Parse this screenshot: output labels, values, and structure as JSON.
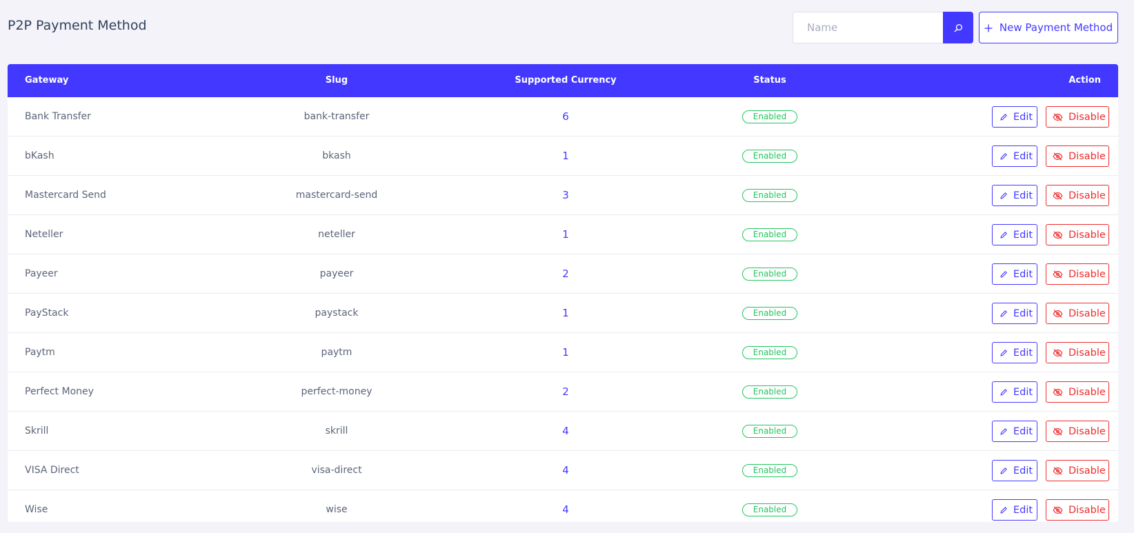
{
  "page": {
    "title": "P2P Payment Method"
  },
  "search": {
    "placeholder": "Name",
    "icon": "search-icon"
  },
  "new_button": {
    "label": "New Payment Method",
    "icon": "plus-icon"
  },
  "table": {
    "headers": {
      "gateway": "Gateway",
      "slug": "Slug",
      "currency": "Supported Currency",
      "status": "Status",
      "action": "Action"
    },
    "rows": [
      {
        "gateway": "Bank Transfer",
        "slug": "bank-transfer",
        "currency": "6",
        "status": "Enabled"
      },
      {
        "gateway": "bKash",
        "slug": "bkash",
        "currency": "1",
        "status": "Enabled"
      },
      {
        "gateway": "Mastercard Send",
        "slug": "mastercard-send",
        "currency": "3",
        "status": "Enabled"
      },
      {
        "gateway": "Neteller",
        "slug": "neteller",
        "currency": "1",
        "status": "Enabled"
      },
      {
        "gateway": "Payeer",
        "slug": "payeer",
        "currency": "2",
        "status": "Enabled"
      },
      {
        "gateway": "PayStack",
        "slug": "paystack",
        "currency": "1",
        "status": "Enabled"
      },
      {
        "gateway": "Paytm",
        "slug": "paytm",
        "currency": "1",
        "status": "Enabled"
      },
      {
        "gateway": "Perfect Money",
        "slug": "perfect-money",
        "currency": "2",
        "status": "Enabled"
      },
      {
        "gateway": "Skrill",
        "slug": "skrill",
        "currency": "4",
        "status": "Enabled"
      },
      {
        "gateway": "VISA Direct",
        "slug": "visa-direct",
        "currency": "4",
        "status": "Enabled"
      },
      {
        "gateway": "Wise",
        "slug": "wise",
        "currency": "4",
        "status": "Enabled"
      }
    ],
    "edit_label": "Edit",
    "disable_label": "Disable"
  },
  "colors": {
    "primary": "#4338ff",
    "success": "#22c55e",
    "danger": "#ef2b2b",
    "background": "#f3f3f9"
  }
}
